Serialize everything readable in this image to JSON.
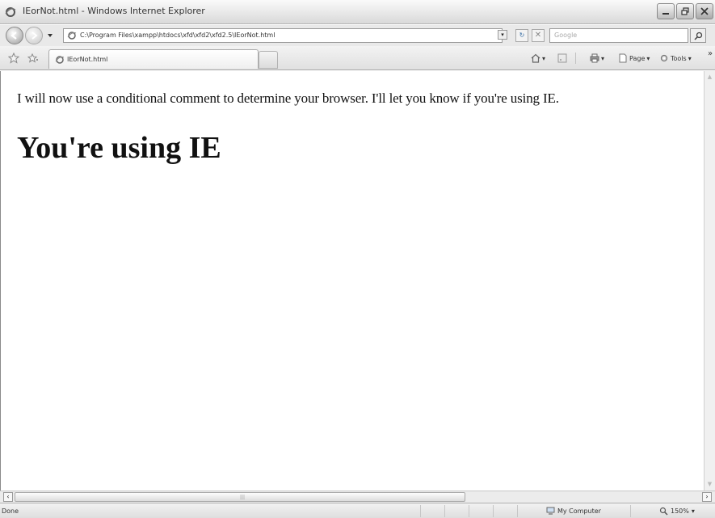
{
  "window": {
    "title": "IEorNot.html - Windows Internet Explorer"
  },
  "toolbar": {
    "address_url": "C:\\Program Files\\xampp\\htdocs\\xfd\\xfd2\\xfd2.5\\IEorNot.html",
    "search_placeholder": "Google"
  },
  "tabs": [
    {
      "label": "IEorNot.html"
    }
  ],
  "command_bar": {
    "page_label": "Page",
    "tools_label": "Tools"
  },
  "content": {
    "paragraph": "I will now use a conditional comment to determine your browser. I'll let you know if you're using IE.",
    "heading": "You're using IE"
  },
  "status_bar": {
    "status": "Done",
    "zone": "My Computer",
    "zoom": "150%"
  },
  "colors": {
    "accent": "#3a6ea5",
    "chrome": "#e9e9e9"
  }
}
